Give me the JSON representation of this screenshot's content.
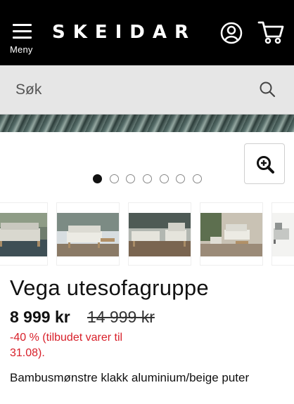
{
  "header": {
    "menu_label": "Meny",
    "logo_text": "SKEIDAR",
    "background": "#000000"
  },
  "search": {
    "placeholder": "Søk"
  },
  "gallery": {
    "dot_count": 7,
    "active_dot": 1,
    "thumbnails": [
      "sofa-set-pool",
      "sofa-set-deck",
      "sofa-chairs-pool",
      "sofa-set-garden",
      "sofa-chair-corner"
    ]
  },
  "product": {
    "title": "Vega utesofagruppe",
    "price": "8 999 kr",
    "old_price": "14 999 kr",
    "discount_text": "-40 % (tilbudet varer til 31.08).",
    "description": "Bambusmønstre klakk aluminium/beige puter"
  },
  "colors": {
    "discount": "#d8202a"
  }
}
